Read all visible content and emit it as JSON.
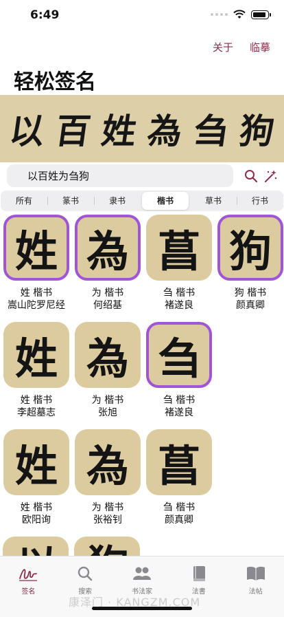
{
  "status": {
    "time": "6:49"
  },
  "header": {
    "about_label": "关于",
    "trace_label": "临摹",
    "title": "轻松签名"
  },
  "banner": {
    "chars": [
      "以",
      "百",
      "姓",
      "為",
      "刍",
      "狗"
    ]
  },
  "search": {
    "value": "以百姓为刍狗"
  },
  "segments": [
    {
      "label": "所有",
      "active": false
    },
    {
      "label": "篆书",
      "active": false
    },
    {
      "label": "隶书",
      "active": false
    },
    {
      "label": "楷书",
      "active": true
    },
    {
      "label": "草书",
      "active": false
    },
    {
      "label": "行书",
      "active": false
    }
  ],
  "grid": [
    {
      "glyph": "姓",
      "line1": "姓 楷书",
      "line2": "嵩山陀罗尼经",
      "selected": true
    },
    {
      "glyph": "為",
      "line1": "为 楷书",
      "line2": "何绍基",
      "selected": true
    },
    {
      "glyph": "菖",
      "line1": "刍 楷书",
      "line2": "褚遂良",
      "selected": false
    },
    {
      "glyph": "狗",
      "line1": "狗 楷书",
      "line2": "颜真卿",
      "selected": true
    },
    {
      "glyph": "姓",
      "line1": "姓 楷书",
      "line2": "李超墓志",
      "selected": false
    },
    {
      "glyph": "為",
      "line1": "为 楷书",
      "line2": "张旭",
      "selected": false
    },
    {
      "glyph": "刍",
      "line1": "刍 楷书",
      "line2": "褚遂良",
      "selected": true
    },
    {
      "glyph": "姓",
      "line1": "姓 楷书",
      "line2": "欧阳询",
      "selected": false
    },
    {
      "glyph": "為",
      "line1": "为 楷书",
      "line2": "张裕钊",
      "selected": false
    },
    {
      "glyph": "菖",
      "line1": "刍 楷书",
      "line2": "颜真卿",
      "selected": false
    }
  ],
  "peek": [
    "以",
    "狗"
  ],
  "tabs": [
    {
      "label": "签名",
      "icon": "signature-icon",
      "active": true
    },
    {
      "label": "搜索",
      "icon": "search-icon",
      "active": false
    },
    {
      "label": "书法家",
      "icon": "people-icon",
      "active": false
    },
    {
      "label": "法書",
      "icon": "book-icon",
      "active": false
    },
    {
      "label": "法帖",
      "icon": "open-book-icon",
      "active": false
    }
  ],
  "watermark": "康泽门 · KANGZM.COM",
  "colors": {
    "accent": "#8b2d4e",
    "tile": "#ddcba0",
    "selected_border": "#a055d6",
    "banner": "#ddcfa8"
  }
}
